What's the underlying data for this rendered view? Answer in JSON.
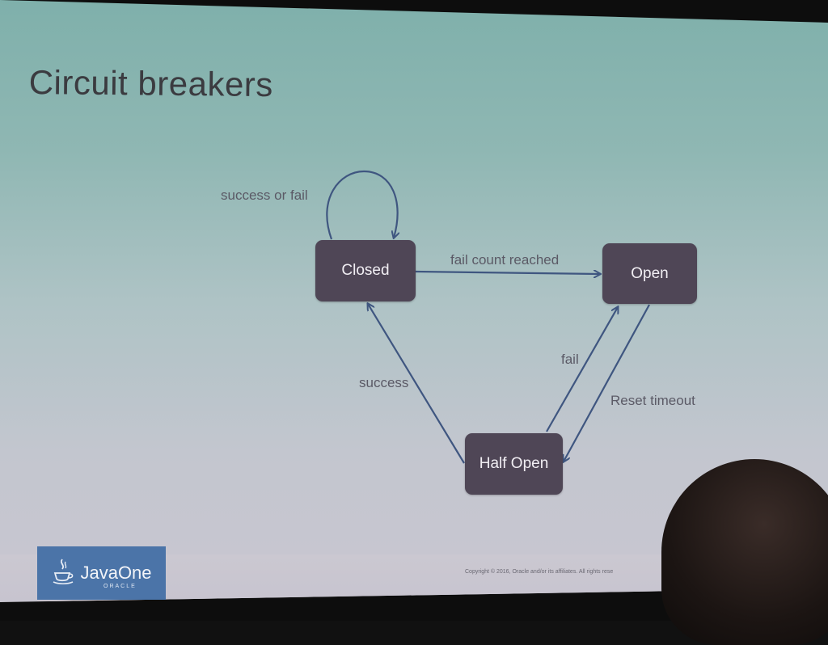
{
  "slide": {
    "title": "Circuit breakers"
  },
  "diagram": {
    "nodes": {
      "closed": "Closed",
      "open": "Open",
      "half_open": "Half Open"
    },
    "edge_labels": {
      "self_loop": "success or fail",
      "closed_to_open": "fail count reached",
      "half_open_to_open": "fail",
      "open_to_half_open": "Reset timeout",
      "half_open_to_closed": "success"
    }
  },
  "footer": {
    "logo_text": "JavaOne",
    "logo_subtext": "ORACLE",
    "copyright": "Copyright © 2016, Oracle and/or its affiliates. All rights rese"
  },
  "colors": {
    "node_fill": "#4f4656",
    "edge_stroke": "#3f5680",
    "logo_blue": "#4b74a8"
  },
  "icons": {
    "logo": "java-cup-icon"
  }
}
